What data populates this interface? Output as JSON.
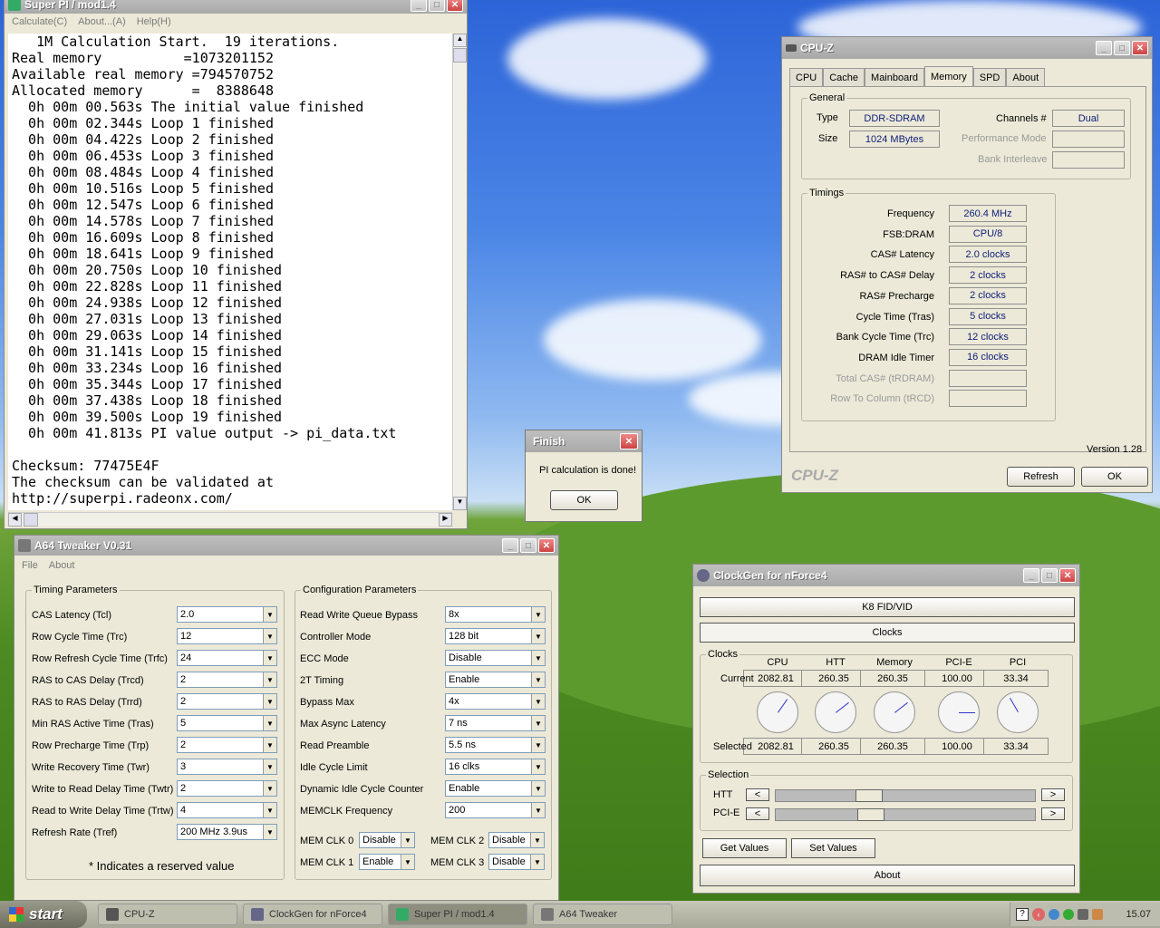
{
  "superpi": {
    "title": "Super PI / mod1.4",
    "menu": [
      "Calculate(C)",
      "About...(A)",
      "Help(H)"
    ],
    "lines": [
      "   1M Calculation Start.  19 iterations.",
      "Real memory          =1073201152",
      "Available real memory =794570752",
      "Allocated memory      =  8388648",
      "  0h 00m 00.563s The initial value finished",
      "  0h 00m 02.344s Loop 1 finished",
      "  0h 00m 04.422s Loop 2 finished",
      "  0h 00m 06.453s Loop 3 finished",
      "  0h 00m 08.484s Loop 4 finished",
      "  0h 00m 10.516s Loop 5 finished",
      "  0h 00m 12.547s Loop 6 finished",
      "  0h 00m 14.578s Loop 7 finished",
      "  0h 00m 16.609s Loop 8 finished",
      "  0h 00m 18.641s Loop 9 finished",
      "  0h 00m 20.750s Loop 10 finished",
      "  0h 00m 22.828s Loop 11 finished",
      "  0h 00m 24.938s Loop 12 finished",
      "  0h 00m 27.031s Loop 13 finished",
      "  0h 00m 29.063s Loop 14 finished",
      "  0h 00m 31.141s Loop 15 finished",
      "  0h 00m 33.234s Loop 16 finished",
      "  0h 00m 35.344s Loop 17 finished",
      "  0h 00m 37.438s Loop 18 finished",
      "  0h 00m 39.500s Loop 19 finished",
      "  0h 00m 41.813s PI value output -> pi_data.txt",
      "",
      "Checksum: 77475E4F",
      "The checksum can be validated at",
      "http://superpi.radeonx.com/"
    ]
  },
  "finish": {
    "title": "Finish",
    "message": "PI calculation is done!",
    "ok": "OK"
  },
  "cpuz": {
    "title": "CPU-Z",
    "tabs": [
      "CPU",
      "Cache",
      "Mainboard",
      "Memory",
      "SPD",
      "About"
    ],
    "active_tab": "Memory",
    "general_label": "General",
    "type_label": "Type",
    "type_value": "DDR-SDRAM",
    "size_label": "Size",
    "size_value": "1024 MBytes",
    "channels_label": "Channels #",
    "channels_value": "Dual",
    "perf_label": "Performance Mode",
    "bank_label": "Bank Interleave",
    "timings_label": "Timings",
    "timings": [
      {
        "label": "Frequency",
        "value": "260.4 MHz",
        "enabled": true
      },
      {
        "label": "FSB:DRAM",
        "value": "CPU/8",
        "enabled": true
      },
      {
        "label": "CAS# Latency",
        "value": "2.0 clocks",
        "enabled": true
      },
      {
        "label": "RAS# to CAS# Delay",
        "value": "2 clocks",
        "enabled": true
      },
      {
        "label": "RAS# Precharge",
        "value": "2 clocks",
        "enabled": true
      },
      {
        "label": "Cycle Time (Tras)",
        "value": "5 clocks",
        "enabled": true
      },
      {
        "label": "Bank Cycle Time (Trc)",
        "value": "12 clocks",
        "enabled": true
      },
      {
        "label": "DRAM Idle Timer",
        "value": "16 clocks",
        "enabled": true
      },
      {
        "label": "Total CAS# (tRDRAM)",
        "value": "",
        "enabled": false
      },
      {
        "label": "Row To Column (tRCD)",
        "value": "",
        "enabled": false
      }
    ],
    "version": "Version 1.28",
    "brand": "CPU-Z",
    "refresh": "Refresh",
    "ok": "OK"
  },
  "a64": {
    "title": "A64 Tweaker V0.31",
    "menu": [
      "File",
      "About"
    ],
    "timing_group": "Timing Parameters",
    "config_group": "Configuration Parameters",
    "timing": [
      {
        "label": "CAS Latency (Tcl)",
        "value": "2.0"
      },
      {
        "label": "Row Cycle Time (Trc)",
        "value": "12"
      },
      {
        "label": "Row Refresh Cycle Time (Trfc)",
        "value": "24"
      },
      {
        "label": "RAS to CAS Delay (Trcd)",
        "value": "2"
      },
      {
        "label": "RAS to RAS Delay (Trrd)",
        "value": "2"
      },
      {
        "label": "Min RAS Active Time (Tras)",
        "value": "5"
      },
      {
        "label": "Row Precharge Time (Trp)",
        "value": "2"
      },
      {
        "label": "Write Recovery Time (Twr)",
        "value": "3"
      },
      {
        "label": "Write to Read Delay Time (Twtr)",
        "value": "2"
      },
      {
        "label": "Read to Write Delay Time (Trtw)",
        "value": "4"
      },
      {
        "label": "Refresh Rate (Tref)",
        "value": "200 MHz 3.9us"
      }
    ],
    "config": [
      {
        "label": "Read Write Queue Bypass",
        "value": "8x"
      },
      {
        "label": "Controller Mode",
        "value": "128 bit"
      },
      {
        "label": "ECC Mode",
        "value": "Disable"
      },
      {
        "label": "2T Timing",
        "value": "Enable"
      },
      {
        "label": "Bypass Max",
        "value": "4x"
      },
      {
        "label": "Max Async Latency",
        "value": "7 ns"
      },
      {
        "label": "Read Preamble",
        "value": "5.5 ns"
      },
      {
        "label": "Idle Cycle Limit",
        "value": "16 clks"
      },
      {
        "label": "Dynamic Idle Cycle Counter",
        "value": "Enable"
      },
      {
        "label": "MEMCLK Frequency",
        "value": "200"
      }
    ],
    "memclk": [
      {
        "label": "MEM CLK 0",
        "value": "Disable"
      },
      {
        "label": "MEM CLK 1",
        "value": "Enable"
      },
      {
        "label": "MEM CLK 2",
        "value": "Disable"
      },
      {
        "label": "MEM CLK 3",
        "value": "Disable"
      }
    ],
    "note": "* Indicates a reserved value"
  },
  "clockgen": {
    "title": "ClockGen for nForce4",
    "k8_button": "K8 FID/VID",
    "clocks_button": "Clocks",
    "clocks_group": "Clocks",
    "columns": [
      "CPU",
      "HTT",
      "Memory",
      "PCI-E",
      "PCI"
    ],
    "current_label": "Current",
    "selected_label": "Selected",
    "current": [
      "2082.81",
      "260.35",
      "260.35",
      "100.00",
      "33.34"
    ],
    "selected": [
      "2082.81",
      "260.35",
      "260.35",
      "100.00",
      "33.34"
    ],
    "selection_group": "Selection",
    "htt_label": "HTT",
    "pcie_label": "PCI-E",
    "htt_slider_fraction": 0.34,
    "pcie_slider_fraction": 0.35,
    "get_values": "Get Values",
    "set_values": "Set Values",
    "about": "About"
  },
  "taskbar": {
    "start": "start",
    "items": [
      "CPU-Z",
      "ClockGen for nForce4",
      "Super PI / mod1.4",
      "A64 Tweaker"
    ],
    "active_index": 2,
    "clock": "15.07"
  }
}
